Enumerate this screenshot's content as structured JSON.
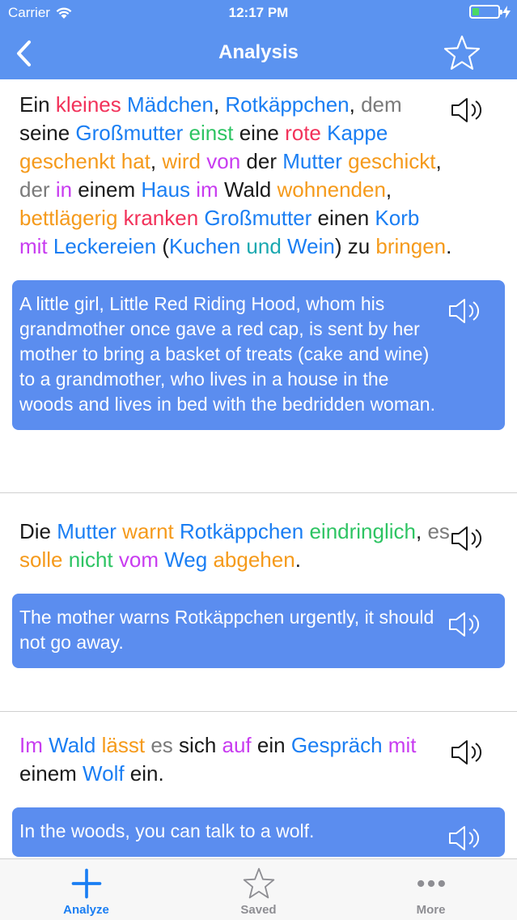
{
  "status_bar": {
    "carrier": "Carrier",
    "time": "12:17 PM",
    "battery_level": 0.25
  },
  "nav": {
    "title": "Analysis",
    "back_icon": "chevron-left-icon",
    "favorite_icon": "star-outline-icon"
  },
  "colors": {
    "header_bg": "#5b93f0",
    "card_bg": "#5b8def",
    "red": "#f2325a",
    "blue": "#1a7ef3",
    "green": "#2ec463",
    "orange": "#f59a1b",
    "purple": "#c83cf0",
    "gray": "#7a7a7a",
    "black": "#1a1a1a",
    "teal": "#1aa8b0",
    "tab_active": "#1a7ef3",
    "tab_inactive": "#8e8e93"
  },
  "sections": [
    {
      "sentence": [
        {
          "t": "Ein ",
          "c": "black"
        },
        {
          "t": "kleines",
          "c": "red"
        },
        {
          "t": " ",
          "c": "black"
        },
        {
          "t": "Mädchen",
          "c": "blue"
        },
        {
          "t": ", ",
          "c": "black"
        },
        {
          "t": "Rotkäppchen",
          "c": "blue"
        },
        {
          "t": ", ",
          "c": "black"
        },
        {
          "t": "dem",
          "c": "gray"
        },
        {
          "t": " seine ",
          "c": "black"
        },
        {
          "t": "Großmutter",
          "c": "blue"
        },
        {
          "t": " ",
          "c": "black"
        },
        {
          "t": "einst",
          "c": "green"
        },
        {
          "t": " eine ",
          "c": "black"
        },
        {
          "t": "rote",
          "c": "red"
        },
        {
          "t": " ",
          "c": "black"
        },
        {
          "t": "Kappe",
          "c": "blue"
        },
        {
          "t": " ",
          "c": "black"
        },
        {
          "t": "geschenkt hat",
          "c": "orange"
        },
        {
          "t": ", ",
          "c": "black"
        },
        {
          "t": "wird",
          "c": "orange"
        },
        {
          "t": " ",
          "c": "black"
        },
        {
          "t": "von",
          "c": "purple"
        },
        {
          "t": " der ",
          "c": "black"
        },
        {
          "t": "Mutter",
          "c": "blue"
        },
        {
          "t": " ",
          "c": "black"
        },
        {
          "t": "geschickt",
          "c": "orange"
        },
        {
          "t": ", ",
          "c": "black"
        },
        {
          "t": "der",
          "c": "gray"
        },
        {
          "t": " ",
          "c": "black"
        },
        {
          "t": "in",
          "c": "purple"
        },
        {
          "t": " einem ",
          "c": "black"
        },
        {
          "t": "Haus",
          "c": "blue"
        },
        {
          "t": " ",
          "c": "black"
        },
        {
          "t": "im",
          "c": "purple"
        },
        {
          "t": " ",
          "c": "black"
        },
        {
          "t": "Wald",
          "c": "black"
        },
        {
          "t": " ",
          "c": "black"
        },
        {
          "t": "wohnenden",
          "c": "orange"
        },
        {
          "t": ", ",
          "c": "black"
        },
        {
          "t": "bettlägerig",
          "c": "orange"
        },
        {
          "t": " ",
          "c": "black"
        },
        {
          "t": "kranken",
          "c": "red"
        },
        {
          "t": " ",
          "c": "black"
        },
        {
          "t": "Großmutter",
          "c": "blue"
        },
        {
          "t": " einen ",
          "c": "black"
        },
        {
          "t": "Korb",
          "c": "blue"
        },
        {
          "t": " ",
          "c": "black"
        },
        {
          "t": "mit",
          "c": "purple"
        },
        {
          "t": " ",
          "c": "black"
        },
        {
          "t": "Leckereien",
          "c": "blue"
        },
        {
          "t": " (",
          "c": "black"
        },
        {
          "t": "Kuchen",
          "c": "blue"
        },
        {
          "t": " ",
          "c": "black"
        },
        {
          "t": "und",
          "c": "teal"
        },
        {
          "t": " ",
          "c": "black"
        },
        {
          "t": "Wein",
          "c": "blue"
        },
        {
          "t": ") zu ",
          "c": "black"
        },
        {
          "t": "bringen",
          "c": "orange"
        },
        {
          "t": ".",
          "c": "black"
        }
      ],
      "translation": "A little girl, Little Red Riding Hood, whom his grandmother once gave a red cap, is sent by her mother to bring a basket of treats (cake and wine) to a grandmother, who lives in a house in the woods and lives in bed with the bedridden woman."
    },
    {
      "sentence": [
        {
          "t": "Die ",
          "c": "black"
        },
        {
          "t": "Mutter",
          "c": "blue"
        },
        {
          "t": " ",
          "c": "black"
        },
        {
          "t": "warnt",
          "c": "orange"
        },
        {
          "t": " ",
          "c": "black"
        },
        {
          "t": "Rotkäppchen",
          "c": "blue"
        },
        {
          "t": " ",
          "c": "black"
        },
        {
          "t": "eindringlich",
          "c": "green"
        },
        {
          "t": ", ",
          "c": "black"
        },
        {
          "t": "es",
          "c": "gray"
        },
        {
          "t": " ",
          "c": "black"
        },
        {
          "t": "solle",
          "c": "orange"
        },
        {
          "t": " ",
          "c": "black"
        },
        {
          "t": "nicht",
          "c": "green"
        },
        {
          "t": " ",
          "c": "black"
        },
        {
          "t": "vom",
          "c": "purple"
        },
        {
          "t": " ",
          "c": "black"
        },
        {
          "t": "Weg",
          "c": "blue"
        },
        {
          "t": " ",
          "c": "black"
        },
        {
          "t": "abgehen",
          "c": "orange"
        },
        {
          "t": ".",
          "c": "black"
        }
      ],
      "translation": "The mother warns Rotkäppchen urgently, it should not go away."
    },
    {
      "sentence": [
        {
          "t": "Im",
          "c": "purple"
        },
        {
          "t": " ",
          "c": "black"
        },
        {
          "t": "Wald",
          "c": "blue"
        },
        {
          "t": " ",
          "c": "black"
        },
        {
          "t": "lässt",
          "c": "orange"
        },
        {
          "t": " ",
          "c": "black"
        },
        {
          "t": "es",
          "c": "gray"
        },
        {
          "t": " sich ",
          "c": "black"
        },
        {
          "t": "auf",
          "c": "purple"
        },
        {
          "t": " ein ",
          "c": "black"
        },
        {
          "t": "Gespräch",
          "c": "blue"
        },
        {
          "t": " ",
          "c": "black"
        },
        {
          "t": "mit",
          "c": "purple"
        },
        {
          "t": " einem ",
          "c": "black"
        },
        {
          "t": "Wolf",
          "c": "blue"
        },
        {
          "t": " ein.",
          "c": "black"
        }
      ],
      "translation": "In the woods, you can talk to a wolf."
    }
  ],
  "speaker_icon": "speaker-icon",
  "tabbar": {
    "active_index": 0,
    "tabs": [
      {
        "label": "Analyze",
        "icon": "plus-icon"
      },
      {
        "label": "Saved",
        "icon": "star-outline-icon"
      },
      {
        "label": "More",
        "icon": "more-dots-icon"
      }
    ]
  }
}
